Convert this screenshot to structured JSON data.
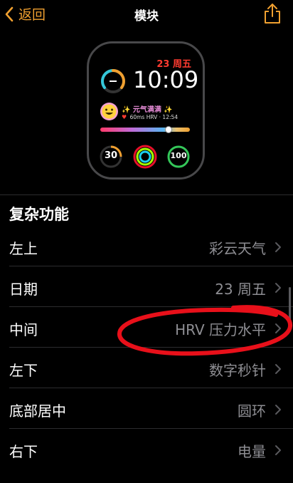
{
  "nav": {
    "back_label": "返回",
    "title": "模块"
  },
  "watch": {
    "date": "23 周五",
    "time": "10:09",
    "weather": "✨ 元气满满 ✨",
    "hrv": "60ms HRV · 12:54",
    "ring_left": "30",
    "ring_right": "100"
  },
  "section": {
    "title": "复杂功能"
  },
  "rows": [
    {
      "label": "左上",
      "value": "彩云天气"
    },
    {
      "label": "日期",
      "value": "23 周五"
    },
    {
      "label": "中间",
      "value": "HRV 压力水平"
    },
    {
      "label": "左下",
      "value": "数字秒针"
    },
    {
      "label": "底部居中",
      "value": "圆环"
    },
    {
      "label": "右下",
      "value": "电量"
    }
  ],
  "colors": {
    "accent": "#f0a030",
    "annotation": "#e8101a",
    "date_red": "#ff3b30",
    "ring_green": "#34c759"
  },
  "icons": {
    "back": "chevron-left-icon",
    "share": "share-icon",
    "row": "chevron-right-icon"
  }
}
